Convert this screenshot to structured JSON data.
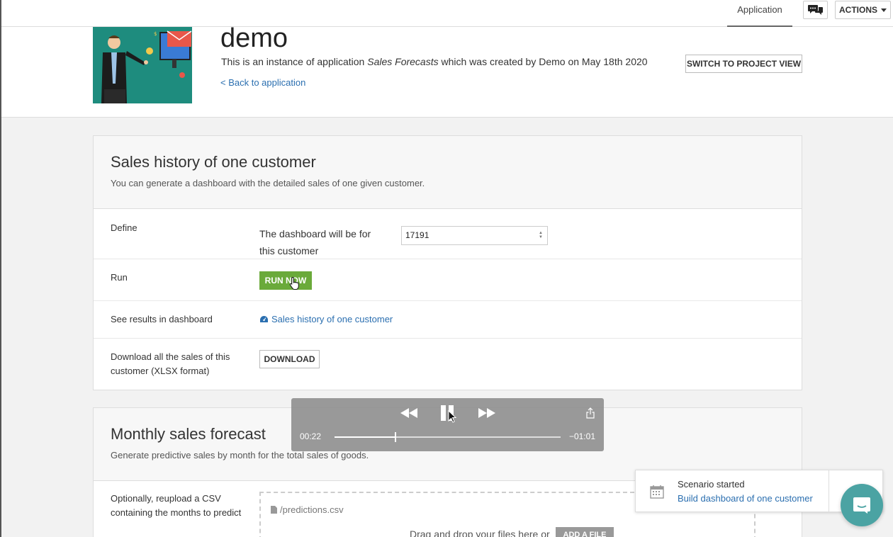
{
  "topbar": {
    "tab_application": "Application",
    "actions_label": "ACTIONS"
  },
  "header": {
    "title": "demo",
    "description_prefix": "This is an instance of application ",
    "description_app": "Sales Forecasts",
    "description_suffix": " which was created by Demo on May 18th 2020",
    "back_link": "< Back to application",
    "switch_button": "SWITCH TO PROJECT VIEW"
  },
  "card_sales_history": {
    "title": "Sales history of one customer",
    "subtitle": "You can generate a dashboard with the detailed sales of one given customer.",
    "define_label": "Define",
    "define_text": "The dashboard will be for this customer",
    "customer_value": "17191",
    "run_label": "Run",
    "run_button": "RUN NOW",
    "results_label": "See results in dashboard",
    "results_link": "Sales history of one customer",
    "download_label": "Download all the sales of this customer (XLSX format)",
    "download_button": "DOWNLOAD"
  },
  "card_monthly_forecast": {
    "title": "Monthly sales forecast",
    "subtitle": "Generate predictive sales by month for the total sales of goods.",
    "upload_label": "Optionally, reupload a CSV containing the months to predict",
    "file_name": "/predictions.csv",
    "drop_text": "Drag and drop your files here or",
    "add_file_button": "ADD A FILE"
  },
  "video": {
    "elapsed": "00:22",
    "remaining": "−01:01",
    "progress": 0.27
  },
  "toast": {
    "title": "Scenario started",
    "link": "Build dashboard of one customer"
  },
  "colors": {
    "accent_green": "#6aaa3a",
    "link_blue": "#2b6fb0",
    "hero_teal": "#1e8c7e",
    "intercom_teal": "#4ba3a3"
  }
}
